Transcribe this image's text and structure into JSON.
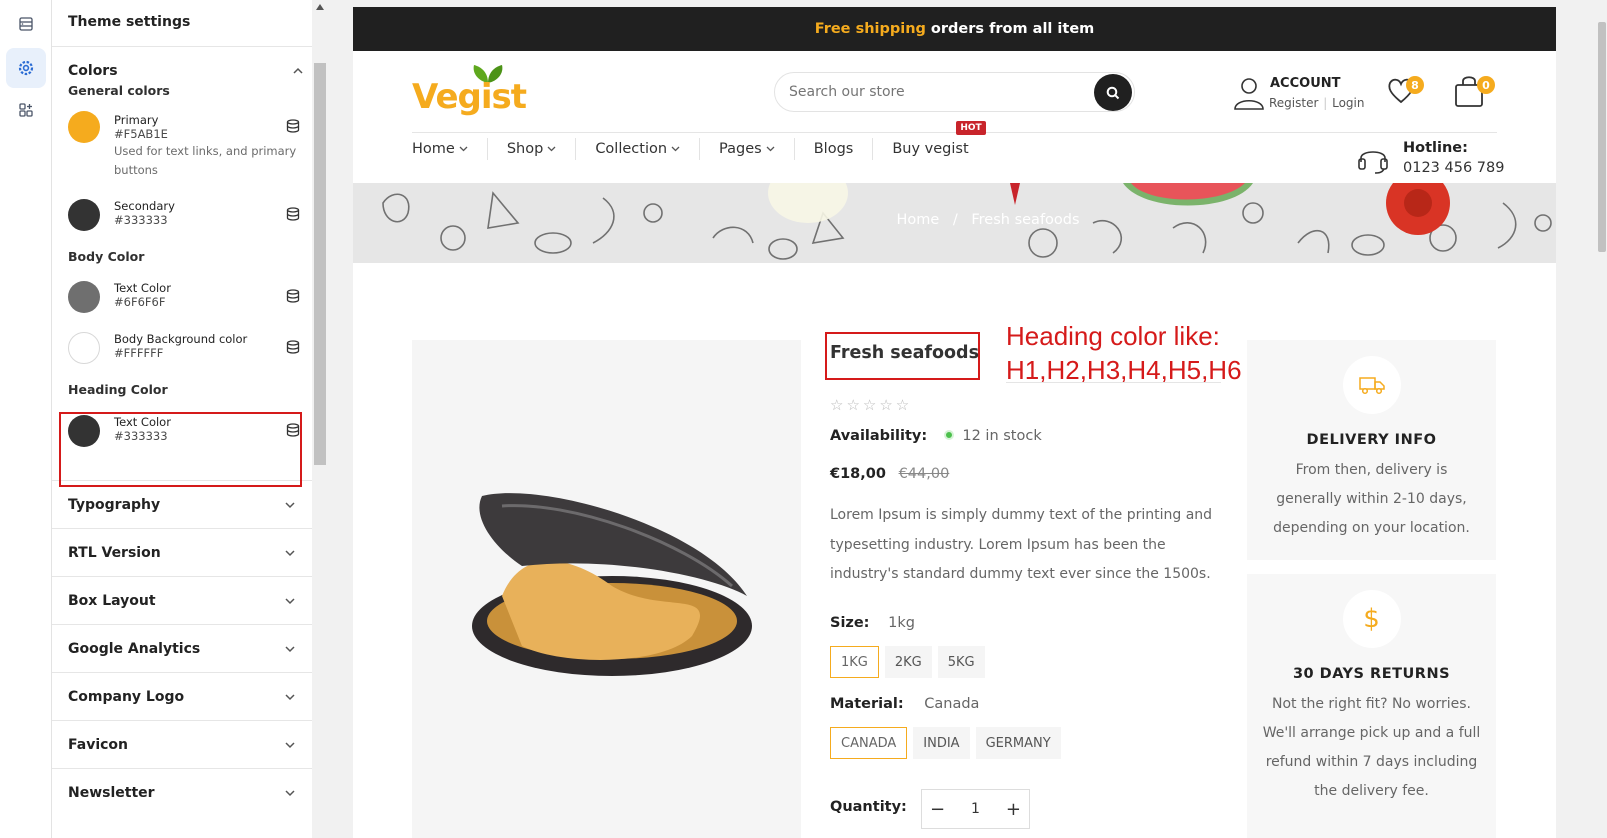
{
  "rail": {
    "icons": [
      "sections-icon",
      "settings-gear-icon",
      "apps-icon"
    ]
  },
  "panel": {
    "title": "Theme settings",
    "colors_section": "Colors",
    "general_colors_title": "General colors",
    "primary": {
      "name": "Primary",
      "hex": "#F5AB1E",
      "help": "Used for text links, and primary buttons"
    },
    "secondary": {
      "name": "Secondary",
      "hex": "#333333"
    },
    "body_color_title": "Body Color",
    "body_text": {
      "name": "Text Color",
      "hex": "#6F6F6F"
    },
    "body_bg": {
      "name": "Body Background color",
      "hex": "#FFFFFF"
    },
    "heading_color_title": "Heading Color",
    "heading_text": {
      "name": "Text Color",
      "hex": "#333333"
    },
    "accordions": [
      "Typography",
      "RTL Version",
      "Box Layout",
      "Google Analytics",
      "Company Logo",
      "Favicon",
      "Newsletter"
    ]
  },
  "store": {
    "topbar": {
      "accent": "Free shipping",
      "rest": "orders from all item"
    },
    "logo": "Vegist",
    "search_placeholder": "Search our store",
    "account": {
      "title": "ACCOUNT",
      "register": "Register",
      "login": "Login"
    },
    "wishlist_count": "8",
    "cart_count": "0",
    "nav": [
      "Home",
      "Shop",
      "Collection",
      "Pages",
      "Blogs",
      "Buy vegist"
    ],
    "hot_badge": "HOT",
    "hotline_label": "Hotline:",
    "hotline_number": "0123 456 789",
    "breadcrumb": {
      "home": "Home",
      "sep": "/",
      "current": "Fresh seafoods"
    },
    "product": {
      "title": "Fresh seafoods",
      "availability_label": "Availability:",
      "stock": "12 in stock",
      "price": "€18,00",
      "old_price": "€44,00",
      "description": "Lorem Ipsum is simply dummy text of the printing and typesetting industry. Lorem Ipsum has been the industry's standard dummy text ever since the 1500s.",
      "size_label": "Size:",
      "size_value": "1kg",
      "sizes": [
        "1KG",
        "2KG",
        "5KG"
      ],
      "material_label": "Material:",
      "material_value": "Canada",
      "materials": [
        "CANADA",
        "INDIA",
        "GERMANY"
      ],
      "quantity_label": "Quantity:",
      "quantity_value": "1",
      "rating_stars": 0
    },
    "annotation": {
      "line1": "Heading color like:",
      "line2": "H1,H2,H3,H4,H5,H6"
    },
    "delivery": {
      "title": "DELIVERY INFO",
      "text": "From then, delivery is generally within 2-10 days, depending on your location."
    },
    "returns": {
      "title": "30 DAYS RETURNS",
      "text": "Not the right fit? No worries. We'll arrange pick up and a full refund within 7 days including the delivery fee."
    }
  },
  "colors": {
    "accent": "#F5AB1E",
    "dark": "#202020",
    "annotation_red": "#D51A1A",
    "logo_green": "#5FA81E"
  }
}
